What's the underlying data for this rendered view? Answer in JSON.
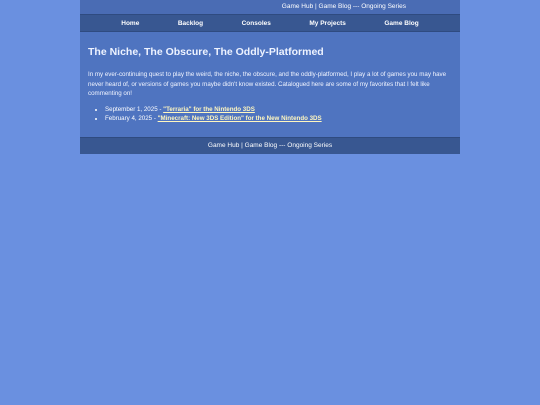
{
  "header": {
    "links": [
      "Game Hub",
      "Game Blog",
      "Ongoing Series"
    ],
    "sep1": " | ",
    "sep2": " --- "
  },
  "nav": {
    "items": [
      "Home",
      "Backlog",
      "Consoles",
      "My Projects",
      "Game Blog"
    ]
  },
  "main": {
    "title": "The Niche, The Obscure, The Oddly-Platformed",
    "intro": "In my ever-continuing quest to play the weird, the niche, the obscure, and the oddly-platformed, I play a lot of games you may have never heard of, or versions of games you maybe didn't know existed. Catalogued here are some of my favorites that I felt like commenting on!",
    "entries": [
      {
        "date": "September 1, 2025 - ",
        "title": "\"Terraria\" for the Nintendo 3DS"
      },
      {
        "date": "February 4, 2025 - ",
        "title": "\"Minecraft: New 3DS Edition\" for the New Nintendo 3DS"
      }
    ]
  },
  "footer": {
    "links": [
      "Game Hub",
      "Game Blog",
      "Ongoing Series"
    ],
    "sep1": " | ",
    "sep2": " --- "
  },
  "colors": {
    "background": "#6a90e0",
    "panel": "#4f74c0",
    "nav": "#385791",
    "link_highlight": "#fff7c0"
  }
}
